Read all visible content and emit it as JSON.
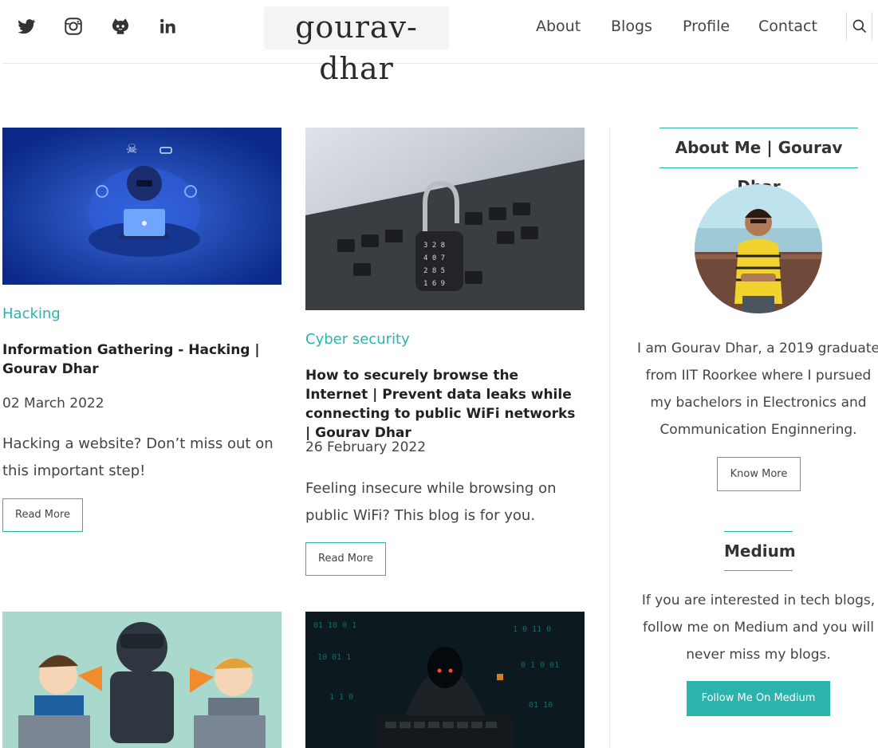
{
  "header": {
    "social": [
      {
        "name": "twitter-icon"
      },
      {
        "name": "instagram-icon"
      },
      {
        "name": "github-icon"
      },
      {
        "name": "linkedin-icon"
      }
    ],
    "logo": "gourav-dhar",
    "nav": [
      "About",
      "Blogs",
      "Profile",
      "Contact"
    ]
  },
  "posts": [
    {
      "category": "Hacking",
      "title": "Information Gathering - Hacking | Gourav Dhar",
      "date": "02 March 2022",
      "description": "Hacking a website? Don’t miss out on this important step!",
      "button": "Read More"
    },
    {
      "category": "Cyber security",
      "title": "How to securely browse the Internet | Prevent data leaks while connecting to public WiFi networks | Gourav Dhar",
      "date": "26 February 2022",
      "description": "Feeling insecure while browsing on public WiFi? This blog is for you.",
      "button": "Read More"
    }
  ],
  "sidebar": {
    "about_title": "About Me | Gourav Dhar",
    "about_text": "I am Gourav Dhar, a 2019 graduate from IIT Roorkee where I pursued my bachelors in Electronics and Communication Enginnering.",
    "know_more": "Know More",
    "medium_title": "Medium",
    "medium_text": "If you are interested in tech blogs, follow me on Medium and you will never miss my blogs.",
    "medium_button": "Follow Me On Medium"
  },
  "colors": {
    "accent": "#2bb3ad",
    "text": "#333333"
  }
}
